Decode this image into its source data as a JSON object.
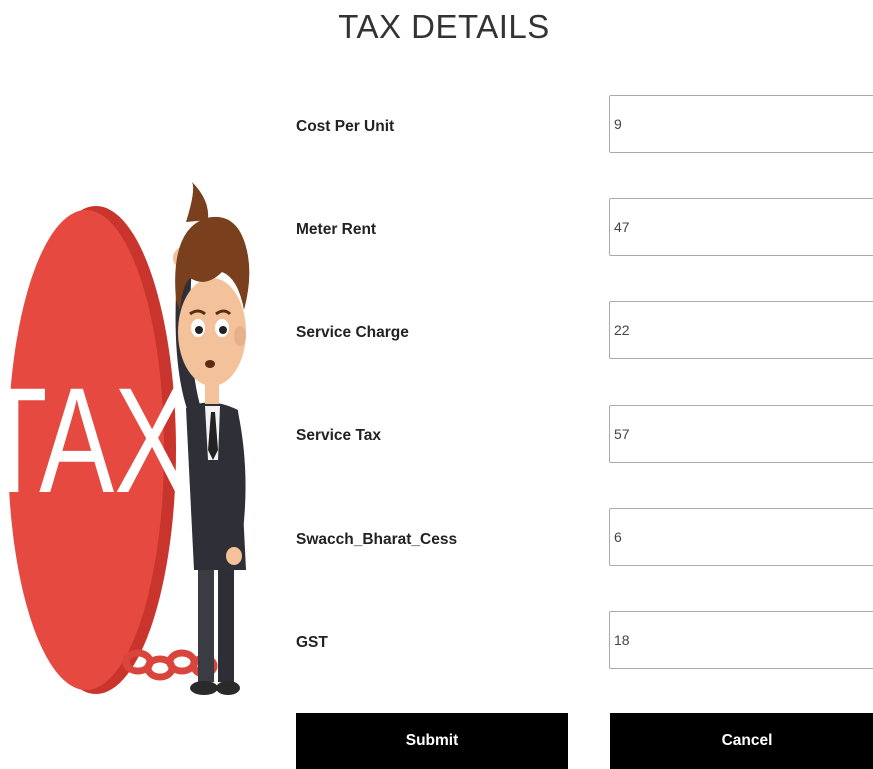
{
  "page": {
    "title": "TAX DETAILS"
  },
  "illustration": {
    "ball_text": "TAX",
    "ball_color": "#e5493f",
    "description_icon": "stressed-man-chained-to-tax-ball-icon"
  },
  "form": {
    "fields": [
      {
        "label": "Cost Per Unit",
        "value": "9"
      },
      {
        "label": "Meter Rent",
        "value": "47"
      },
      {
        "label": "Service Charge",
        "value": "22"
      },
      {
        "label": "Service Tax",
        "value": "57"
      },
      {
        "label": "Swacch_Bharat_Cess",
        "value": "6"
      },
      {
        "label": "GST",
        "value": "18"
      }
    ],
    "submit_label": "Submit",
    "cancel_label": "Cancel"
  },
  "colors": {
    "button_bg": "#000000",
    "button_text": "#ffffff",
    "title_text": "#333333"
  }
}
